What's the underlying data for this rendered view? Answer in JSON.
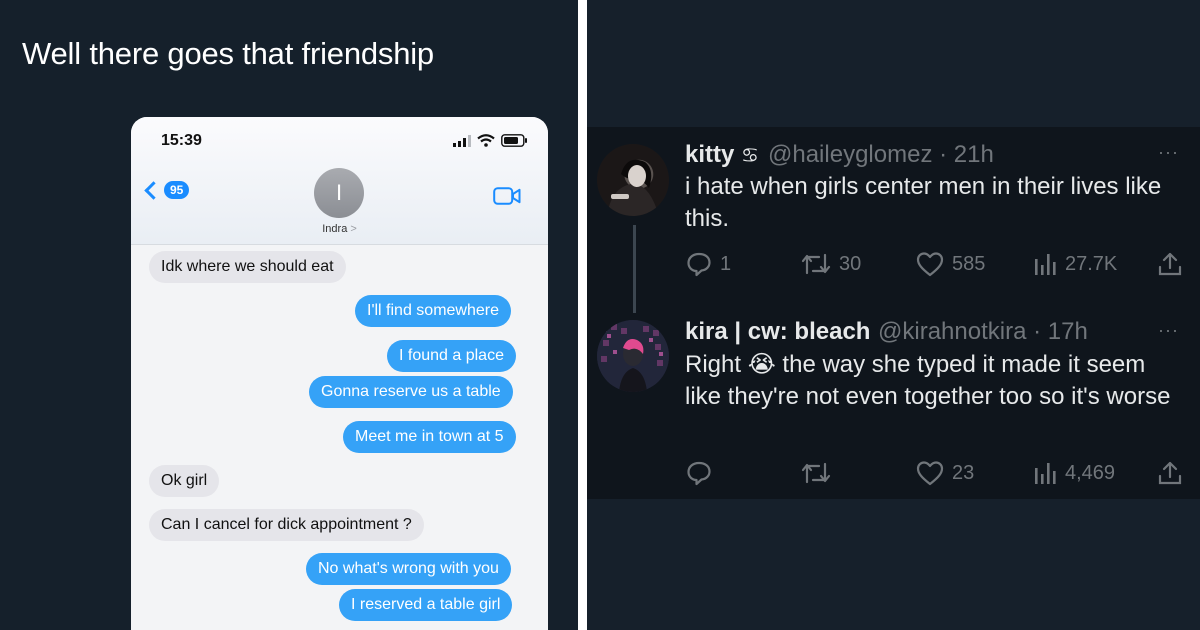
{
  "left": {
    "caption": "Well there goes that friendship",
    "phone": {
      "time": "15:39",
      "back_count": "95",
      "contact_initial": "I",
      "contact_name": "Indra",
      "contact_chevron": ">",
      "messages": [
        {
          "side": "received",
          "text": "Idk where we should eat"
        },
        {
          "side": "sent",
          "text": "I'll find somewhere"
        },
        {
          "side": "sent",
          "text": "I found a place"
        },
        {
          "side": "sent",
          "text": "Gonna reserve us a table"
        },
        {
          "side": "sent",
          "text": "Meet me in town at 5"
        },
        {
          "side": "received",
          "text": "Ok girl"
        },
        {
          "side": "received",
          "text": "Can I cancel for dick appointment ?"
        },
        {
          "side": "sent",
          "text": "No what's wrong with you"
        },
        {
          "side": "sent",
          "text": "I reserved a table girl"
        }
      ]
    }
  },
  "right": {
    "tweets": [
      {
        "name": "kitty",
        "name_symbol": "♋",
        "handle": "@haileyglomez",
        "time": "21h",
        "more": "···",
        "text": "i hate when girls center men in their lives like this.",
        "replies": "1",
        "retweets": "30",
        "likes": "585",
        "views": "27.7K"
      },
      {
        "name": "kira | cw: bleach",
        "handle": "@kirahnotkira",
        "time": "17h",
        "more": "···",
        "text_before_emoji": "Right",
        "emoji": "😭",
        "text_after_emoji": "the way she typed it made it seem like they're not even together too so it's worse",
        "replies": "",
        "retweets": "",
        "likes": "23",
        "views": "4,469"
      }
    ]
  },
  "colors": {
    "dark_bg": "#15202b",
    "ios_blue": "#35a2f7",
    "ios_gray_bubble": "#e5e5ea",
    "twitter_text": "#e7e9ea",
    "twitter_muted": "#71767b"
  }
}
